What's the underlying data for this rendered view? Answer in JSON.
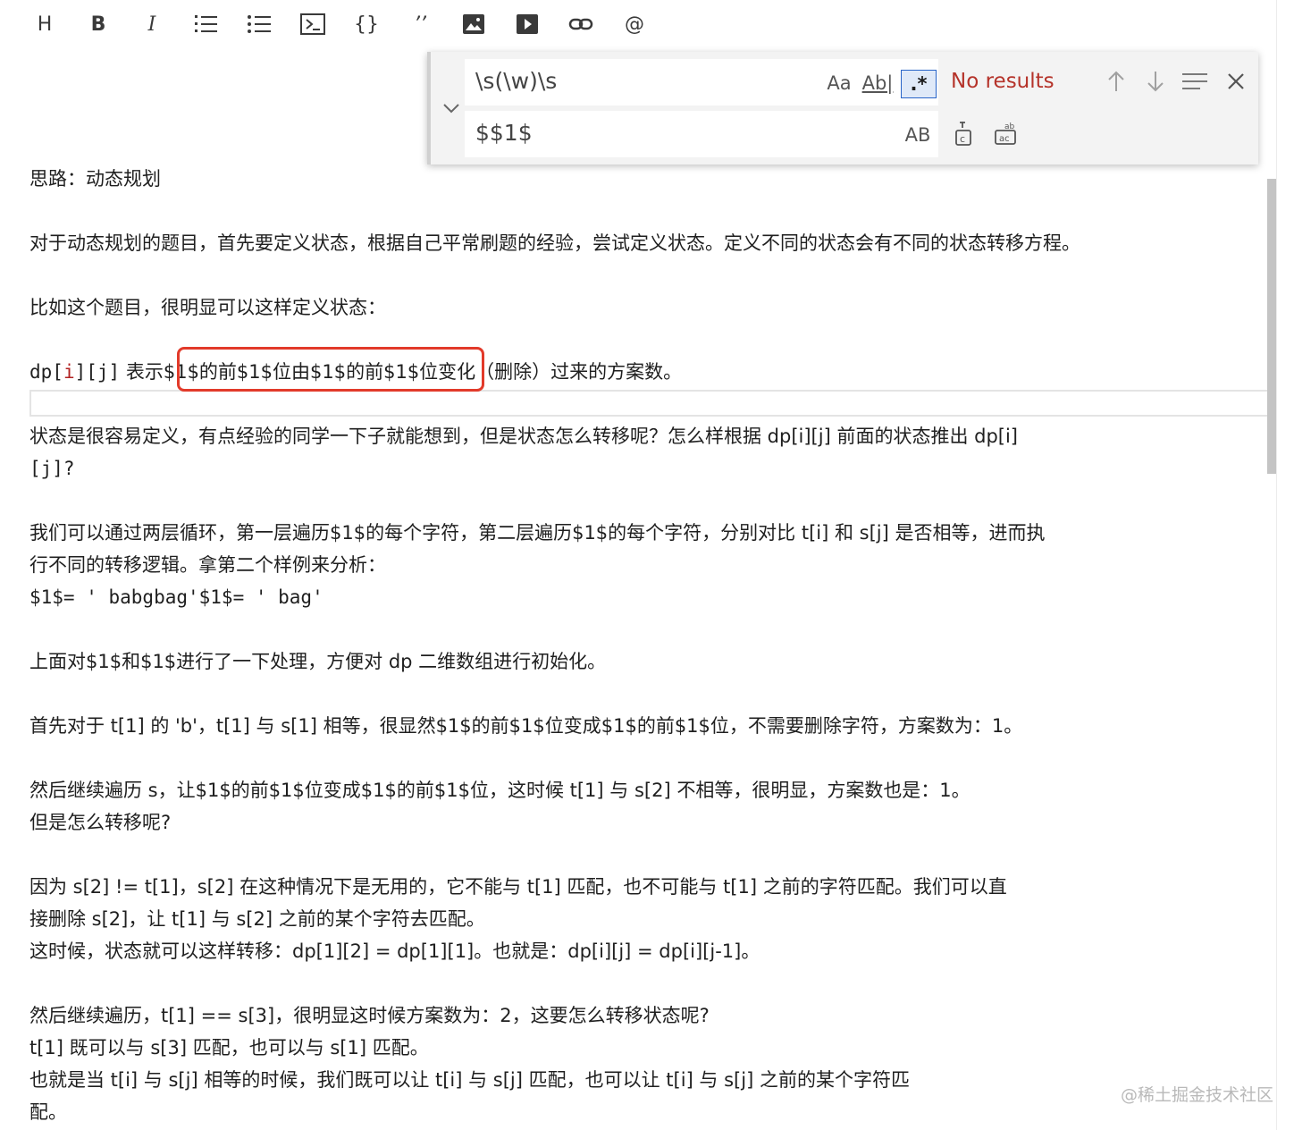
{
  "toolbar": {
    "heading_label": "H",
    "bold_label": "B",
    "italic_label": "I",
    "braces_label": "{}",
    "quote_label": "’’",
    "at_label": "@"
  },
  "find_widget": {
    "search_value": "\\s(\\w)\\s",
    "replace_value": "$$1$",
    "match_case_label": "Aa",
    "whole_word_label": "Ab|",
    "regex_label": ".*",
    "preserve_case_label": "AB",
    "status": "No results"
  },
  "doc": {
    "l1": "思路：动态规划",
    "l2": "对于动态规划的题目，首先要定义状态，根据自己平常刷题的经验，尝试定义状态。定义不同的状态会有不同的状态转移方程。",
    "l3": "比如这个题目，很明显可以这样定义状态：",
    "l4_dp": "dp[",
    "l4_i": "i",
    "l4_mid": "][j]",
    "l4_rest": " 表示$1$的前$1$位由$1$的前$1$位变化（删除）过来的方案数。",
    "l5a": "状态是很容易定义，有点经验的同学一下子就能想到，但是状态怎么转移呢？怎么样根据 dp[i][j] 前面的状态推出 dp[i]",
    "l5b": "[j]?",
    "l6a": "我们可以通过两层循环，第一层遍历$1$的每个字符，第二层遍历$1$的每个字符，分别对比 t[i] 和 s[j] 是否相等，进而执",
    "l6b": "行不同的转移逻辑。拿第二个样例来分析：",
    "l6c": "$1$= ' babgbag'$1$= ' bag'",
    "l7": "上面对$1$和$1$进行了一下处理，方便对 dp 二维数组进行初始化。",
    "l8": "首先对于 t[1] 的 'b'，t[1] 与 s[1] 相等，很显然$1$的前$1$位变成$1$的前$1$位，不需要删除字符，方案数为：1。",
    "l9a": "然后继续遍历 s，让$1$的前$1$位变成$1$的前$1$位，这时候 t[1] 与 s[2] 不相等，很明显，方案数也是：1。",
    "l9b": "但是怎么转移呢?",
    "l10a": "因为 s[2] != t[1]，s[2] 在这种情况下是无用的，它不能与 t[1] 匹配，也不可能与 t[1] 之前的字符匹配。我们可以直",
    "l10b": "接删除 s[2]，让 t[1] 与 s[2] 之前的某个字符去匹配。",
    "l10c": "这时候，状态就可以这样转移：dp[1][2] = dp[1][1]。也就是：dp[i][j] = dp[i][j-1]。",
    "l11a": "然后继续遍历，t[1] == s[3]，很明显这时候方案数为：2，这要怎么转移状态呢?",
    "l11b": "t[1] 既可以与 s[3] 匹配，也可以与 s[1] 匹配。",
    "l11c": "也就是当 t[i] 与 s[j] 相等的时候，我们既可以让 t[i] 与 s[j] 匹配，也可以让 t[i] 与 s[j] 之前的某个字符匹",
    "l11d": "配。"
  },
  "watermark": "@稀土掘金技术社区"
}
